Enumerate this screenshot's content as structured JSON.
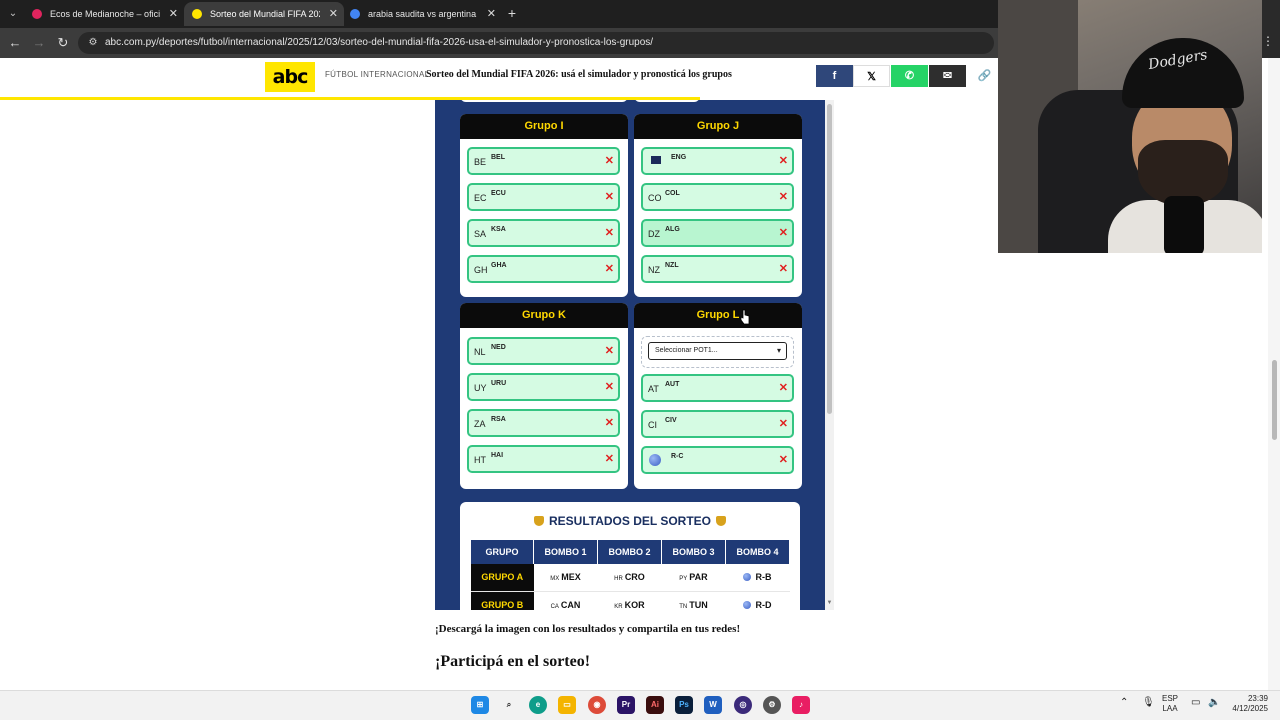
{
  "browser": {
    "tabs": [
      {
        "title": "Ecos de Medianoche – oficial | ",
        "active": false,
        "favicon_color": "#e0245e"
      },
      {
        "title": "Sorteo del Mundial FIFA 2026: u",
        "active": true,
        "favicon_color": "#ffe600"
      },
      {
        "title": "arabia saudita vs argentina - B",
        "active": false,
        "favicon_color": "#4285f4"
      }
    ],
    "url": "abc.com.py/deportes/futbol/internacional/2025/12/03/sorteo-del-mundial-fifa-2026-usa-el-simulador-y-pronostica-los-grupos/"
  },
  "site": {
    "logo": "abc",
    "section": "FÚTBOL INTERNACIONAL",
    "title": "Sorteo del Mundial FIFA 2026: usá el simulador y pronosticá los grupos",
    "share": {
      "facebook": "f",
      "x": "𝕏",
      "whatsapp": "✆",
      "email": "✉",
      "link": "🔗"
    }
  },
  "simulator": {
    "groups": [
      {
        "name": "Grupo I",
        "teams": [
          {
            "code": "BE",
            "abbr": "BEL"
          },
          {
            "code": "EC",
            "abbr": "ECU"
          },
          {
            "code": "SA",
            "abbr": "KSA"
          },
          {
            "code": "GH",
            "abbr": "GHA"
          }
        ]
      },
      {
        "name": "Grupo J",
        "teams": [
          {
            "code": "",
            "abbr": "ENG"
          },
          {
            "code": "CO",
            "abbr": "COL"
          },
          {
            "code": "DZ",
            "abbr": "ALG"
          },
          {
            "code": "NZ",
            "abbr": "NZL"
          }
        ]
      },
      {
        "name": "Grupo K",
        "teams": [
          {
            "code": "NL",
            "abbr": "NED"
          },
          {
            "code": "UY",
            "abbr": "URU"
          },
          {
            "code": "ZA",
            "abbr": "RSA"
          },
          {
            "code": "HT",
            "abbr": "HAI"
          }
        ]
      },
      {
        "name": "Grupo L",
        "select_placeholder": "Seleccionar POT1...",
        "teams": [
          {
            "code": "AT",
            "abbr": "AUT"
          },
          {
            "code": "CI",
            "abbr": "CIV"
          },
          {
            "code": "",
            "abbr": "R-C"
          }
        ]
      }
    ],
    "remove_icon": "✕",
    "results": {
      "title": "RESULTADOS DEL SORTEO",
      "headers": [
        "GRUPO",
        "BOMBO 1",
        "BOMBO 2",
        "BOMBO 3",
        "BOMBO 4"
      ],
      "rows": [
        {
          "group": "GRUPO A",
          "b1_code": "MX",
          "b1": "MEX",
          "b2_code": "HR",
          "b2": "CRO",
          "b3_code": "PY",
          "b3": "PAR",
          "b4": "R-B"
        },
        {
          "group": "GRUPO B",
          "b1_code": "CA",
          "b1": "CAN",
          "b2_code": "KR",
          "b2": "KOR",
          "b3_code": "TN",
          "b3": "TUN",
          "b4": "R-D"
        }
      ]
    }
  },
  "article": {
    "download_text": "¡Descargá la imagen con los resultados y compartila en tus redes!",
    "heading": "¡Participá en el sorteo!"
  },
  "taskbar": {
    "lang": "ESP",
    "lang2": "LAA",
    "time": "23:39",
    "date": "4/12/2025"
  }
}
